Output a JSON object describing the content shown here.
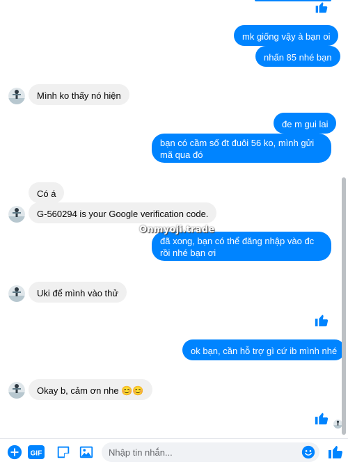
{
  "colors": {
    "outgoing": "#0084ff",
    "incoming": "#f0f0f0",
    "accent": "#0084ff"
  },
  "watermark": "Onmyoji.trade",
  "messages": [
    {
      "side": "out",
      "text": "mk giống vậy à bạn oi"
    },
    {
      "side": "out",
      "text": "nhấn 85 nhé bạn"
    },
    {
      "side": "in",
      "text": "Mình ko thấy nó hiện"
    },
    {
      "side": "out",
      "text": "đe m gui lai"
    },
    {
      "side": "out",
      "text": "bạn có cầm số đt đuôi 56 ko, mình gửi mã qua đó"
    },
    {
      "side": "in",
      "text": "Có á"
    },
    {
      "side": "in",
      "text": "G-560294 is your Google verification code."
    },
    {
      "side": "out",
      "text": "đã xong, bạn có thể đăng nhập vào đc rồi nhé bạn ơi"
    },
    {
      "side": "in",
      "text": "Uki để mình vào thử"
    },
    {
      "side": "out",
      "text": "ok bạn, cần hỗ trợ gì cứ ib mình nhé"
    },
    {
      "side": "in",
      "text": "Okay b, cảm ơn nhe 😊😊"
    }
  ],
  "composer": {
    "placeholder": "Nhập tin nhắn...",
    "gif_label": "GIF"
  },
  "icons": {
    "add": "plus-circle-icon",
    "gif": "gif-icon",
    "sticker": "sticker-icon",
    "image": "image-icon",
    "emoji": "smiley-icon",
    "like": "thumbs-up-icon"
  }
}
